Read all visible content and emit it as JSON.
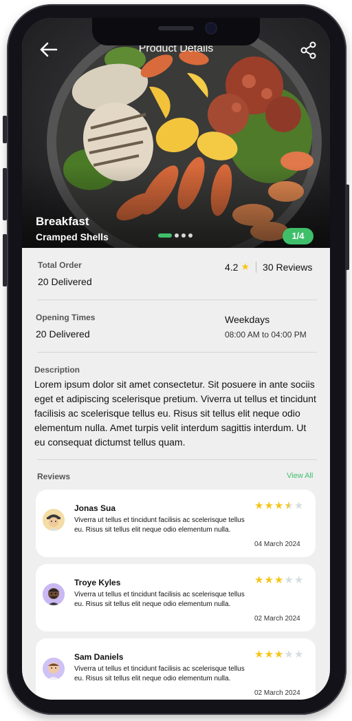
{
  "header": {
    "title": "Product Details"
  },
  "hero": {
    "title": "Breakfast",
    "subtitle": "Cramped Shells",
    "page_indicator": "1/4",
    "dots_total": 4,
    "dots_active": 0
  },
  "stats": {
    "total_order_label": "Total Order",
    "total_order_value": "20 Delivered",
    "rating": "4.2",
    "reviews_count": "30 Reviews",
    "opening_label": "Opening Times",
    "opening_value": "20 Delivered",
    "days": "Weekdays",
    "hours": "08:00 AM to 04:00 PM"
  },
  "description": {
    "label": "Description",
    "text": "Lorem ipsum dolor sit amet consectetur. Sit posuere in ante sociis eget et adipiscing scelerisque pretium. Viverra ut tellus et tincidunt facilisis ac scelerisque tellus eu. Risus sit tellus elit neque odio elementum nulla. Amet turpis velit interdum sagittis interdum. Ut eu consequat dictumst tellus quam."
  },
  "reviews": {
    "label": "Reviews",
    "view_all": "View All",
    "items": [
      {
        "name": "Jonas Sua",
        "text": "Viverra ut tellus et tincidunt facilisis ac scelerisque tellus eu. Risus sit tellus elit neque odio elementum nulla.",
        "date": "04 March 2024",
        "rating": 3.5
      },
      {
        "name": "Troye Kyles",
        "text": "Viverra ut tellus et tincidunt facilisis ac scelerisque tellus eu. Risus sit tellus elit neque odio elementum nulla.",
        "date": "02 March 2024",
        "rating": 3
      },
      {
        "name": "Sam Daniels",
        "text": "Viverra ut tellus et tincidunt facilisis ac scelerisque tellus eu. Risus sit tellus elit neque odio elementum nulla.",
        "date": "02 March 2024",
        "rating": 3
      }
    ]
  },
  "colors": {
    "accent": "#3fbf6a",
    "star": "#f5c518",
    "background": "#efefef"
  },
  "icons": {
    "back": "arrow-left-icon",
    "share": "share-icon",
    "star": "star-icon"
  }
}
